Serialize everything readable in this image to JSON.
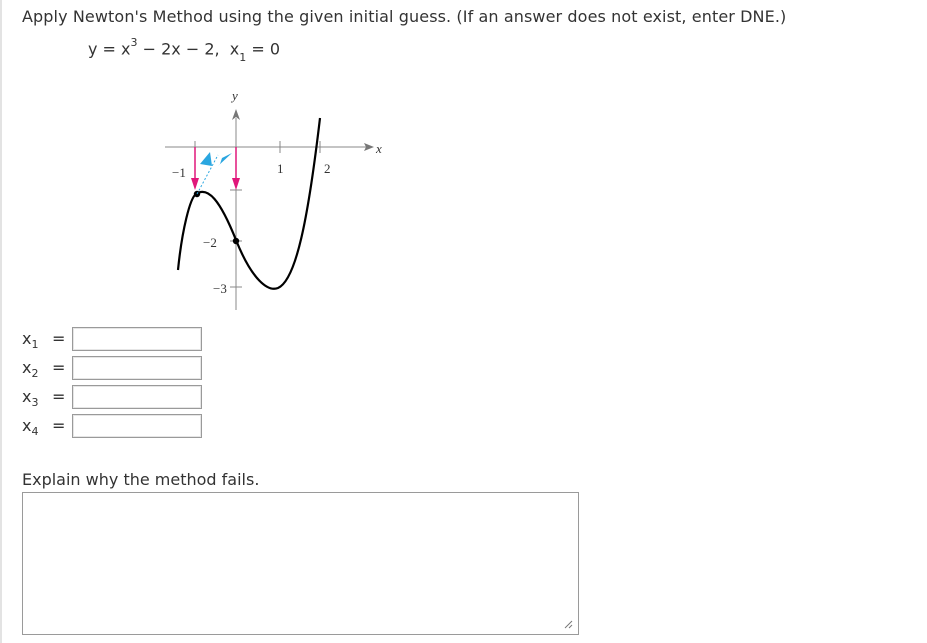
{
  "question": {
    "instructions": "Apply Newton's Method using the given initial guess. (If an answer does not exist, enter DNE.)",
    "equation": {
      "y_lhs": "y = x",
      "exponent": "3",
      "rest": " − 2x − 2,",
      "x_var": "x",
      "x_sub": "1",
      "x_value": " = 0"
    }
  },
  "graph": {
    "y_axis_label": "y",
    "x_axis_label": "x",
    "x_tick_labels": [
      "−1",
      "1",
      "2"
    ],
    "y_tick_labels": [
      "−2",
      "−3"
    ],
    "colors": {
      "curve": "#000000",
      "magenta_arrow": "#e0177a",
      "cyan_arrow": "#2aa6e0",
      "axis": "#888888"
    }
  },
  "answers": [
    {
      "var": "x",
      "sub": "1",
      "eq": "=",
      "value": ""
    },
    {
      "var": "x",
      "sub": "2",
      "eq": "=",
      "value": ""
    },
    {
      "var": "x",
      "sub": "3",
      "eq": "=",
      "value": ""
    },
    {
      "var": "x",
      "sub": "4",
      "eq": "=",
      "value": ""
    }
  ],
  "explain": {
    "label": "Explain why the method fails.",
    "value": ""
  }
}
